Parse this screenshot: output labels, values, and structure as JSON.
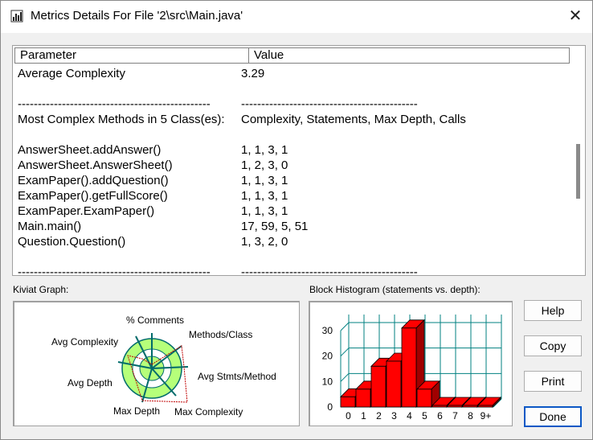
{
  "window": {
    "title": "Metrics Details For File '2\\src\\Main.java'"
  },
  "table": {
    "col_param": "Parameter",
    "col_value": "Value",
    "rows": [
      [
        "Average Complexity",
        "3.29"
      ],
      [
        "",
        ""
      ],
      [
        "------------------------------------------------",
        "--------------------------------------------"
      ],
      [
        "Most Complex Methods in 5 Class(es):",
        "Complexity, Statements, Max Depth, Calls"
      ],
      [
        "",
        ""
      ],
      [
        "AnswerSheet.addAnswer()",
        "1, 1, 3, 1"
      ],
      [
        "AnswerSheet.AnswerSheet()",
        "1, 2, 3, 0"
      ],
      [
        "ExamPaper().addQuestion()",
        "1, 1, 3, 1"
      ],
      [
        "ExamPaper().getFullScore()",
        "1, 1, 3, 1"
      ],
      [
        "ExamPaper.ExamPaper()",
        "1, 1, 3, 1"
      ],
      [
        "Main.main()",
        "17, 59, 5, 51"
      ],
      [
        "Question.Question()",
        "1, 3, 2, 0"
      ],
      [
        "",
        ""
      ],
      [
        "------------------------------------------------",
        "--------------------------------------------"
      ]
    ]
  },
  "kiviat": {
    "label": "Kiviat Graph:",
    "axes": [
      "% Comments",
      "Methods/Class",
      "Avg Stmts/Method",
      "Max Complexity",
      "Max Depth",
      "Avg Depth",
      "Avg Complexity"
    ]
  },
  "histogram": {
    "label": "Block Histogram (statements vs. depth):",
    "colors": {
      "bar": "#ff0000",
      "bar_dark": "#a00000",
      "grid": "#008080"
    },
    "chart_data": {
      "type": "bar",
      "categories": [
        "0",
        "1",
        "2",
        "3",
        "4",
        "5",
        "6",
        "7",
        "8",
        "9+"
      ],
      "values": [
        4,
        7,
        16,
        18,
        31,
        7,
        0,
        0,
        0,
        0
      ],
      "ylim": [
        0,
        30
      ],
      "yticks": [
        "0",
        "10",
        "20",
        "30"
      ]
    }
  },
  "buttons": {
    "help": "Help",
    "copy": "Copy",
    "print": "Print",
    "done": "Done"
  }
}
